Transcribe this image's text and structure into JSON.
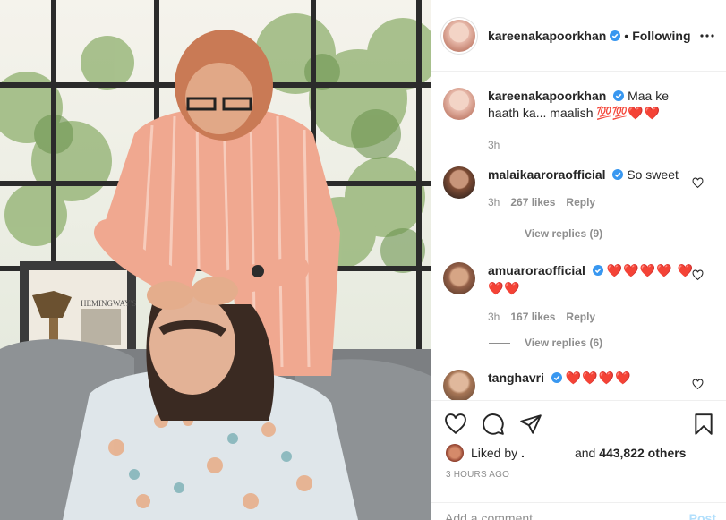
{
  "post": {
    "username": "kareenakapoorkhan",
    "separator": "•",
    "follow_status": "Following"
  },
  "caption": {
    "username": "kareenakapoorkhan",
    "text": "Maa ke haath ka... maalish",
    "emojis": "💯💯",
    "hearts": "❤️❤️",
    "time": "3h"
  },
  "comments": [
    {
      "username": "malaikaaroraofficial",
      "text": "So sweet",
      "hearts": "",
      "time": "3h",
      "likes": "267 likes",
      "reply": "Reply",
      "view_replies": "View replies (9)"
    },
    {
      "username": "amuaroraofficial",
      "text": "",
      "hearts": "❤️❤️❤️❤️ ❤️❤️❤️",
      "time": "3h",
      "likes": "167 likes",
      "reply": "Reply",
      "view_replies": "View replies (6)"
    },
    {
      "username": "tanghavri",
      "text": "",
      "hearts": "❤️❤️❤️❤️",
      "time": "",
      "likes": "",
      "reply": "",
      "view_replies": ""
    }
  ],
  "liked_by": {
    "prefix": "Liked by",
    "name": ".",
    "connector": "and",
    "count": "443,822 others"
  },
  "timeago": "3 HOURS AGO",
  "add_comment": {
    "placeholder": "Add a comment...",
    "post_label": "Post"
  },
  "icons": {
    "verified": "verified-badge-icon",
    "more": "more-options-icon",
    "like": "heart-outline-icon",
    "comment": "comment-bubble-icon",
    "share": "paper-plane-icon",
    "save": "bookmark-icon"
  },
  "colors": {
    "verified": "#3897f0",
    "heart": "#ed1c24",
    "post_disabled": "#b2dffc",
    "muted": "#8e8e8e"
  }
}
